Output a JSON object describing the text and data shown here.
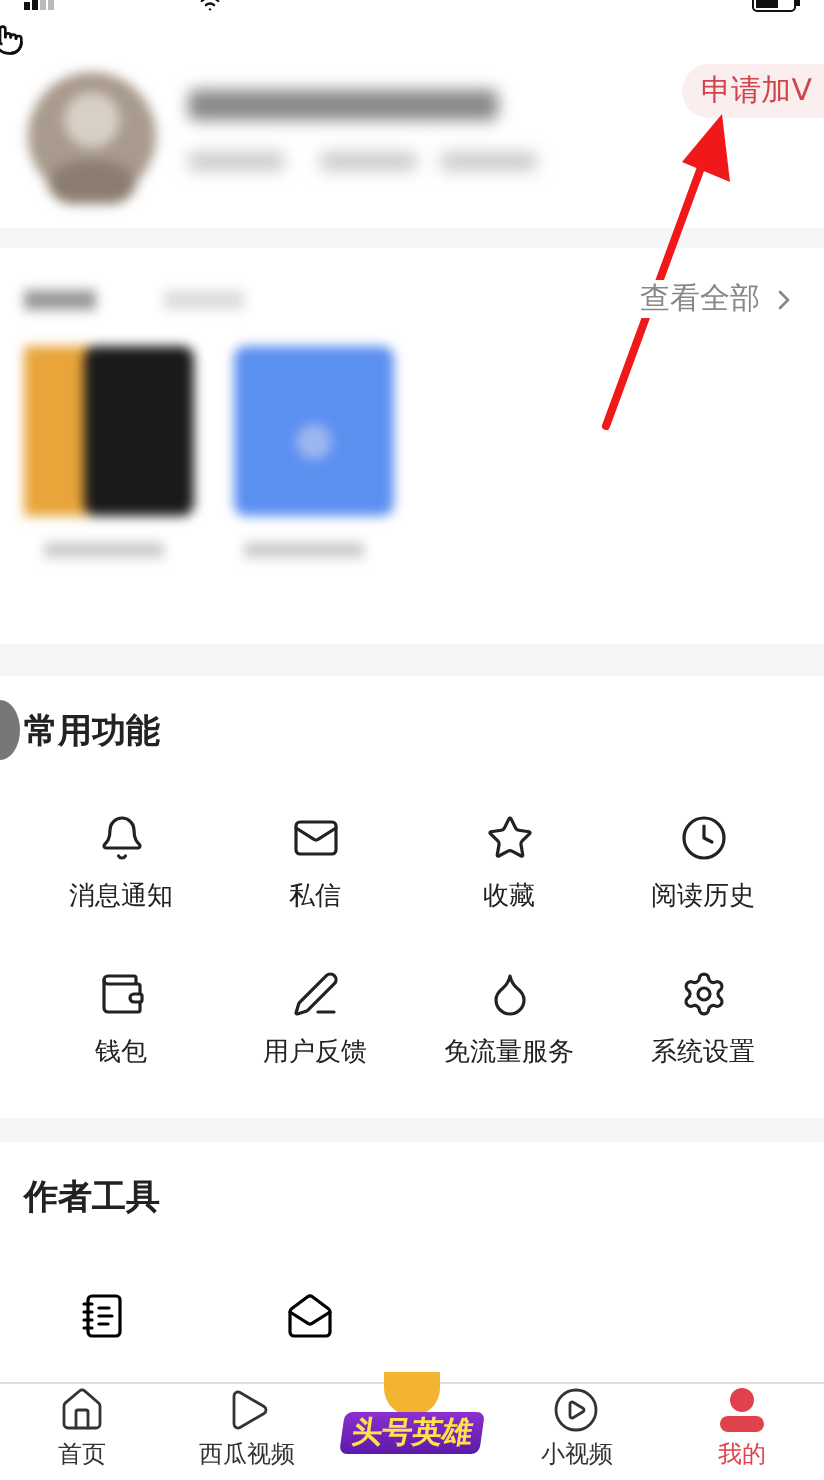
{
  "profile": {
    "badge": "申请加V"
  },
  "works": {
    "link": "查看全部"
  },
  "common_functions": {
    "title": "常用功能",
    "items": [
      {
        "label": "消息通知"
      },
      {
        "label": "私信"
      },
      {
        "label": "收藏"
      },
      {
        "label": "阅读历史"
      },
      {
        "label": "钱包"
      },
      {
        "label": "用户反馈"
      },
      {
        "label": "免流量服务"
      },
      {
        "label": "系统设置"
      }
    ]
  },
  "author_tools": {
    "title": "作者工具"
  },
  "tab_bar": [
    {
      "kind": "tab",
      "label": "首页",
      "selected": false
    },
    {
      "kind": "tab",
      "label": "西瓜视频",
      "selected": false
    },
    {
      "kind": "promo",
      "label": "头号英雄",
      "selected": false
    },
    {
      "kind": "tab",
      "label": "小视频",
      "selected": false
    },
    {
      "kind": "tab",
      "label": "我的",
      "selected": true
    }
  ]
}
